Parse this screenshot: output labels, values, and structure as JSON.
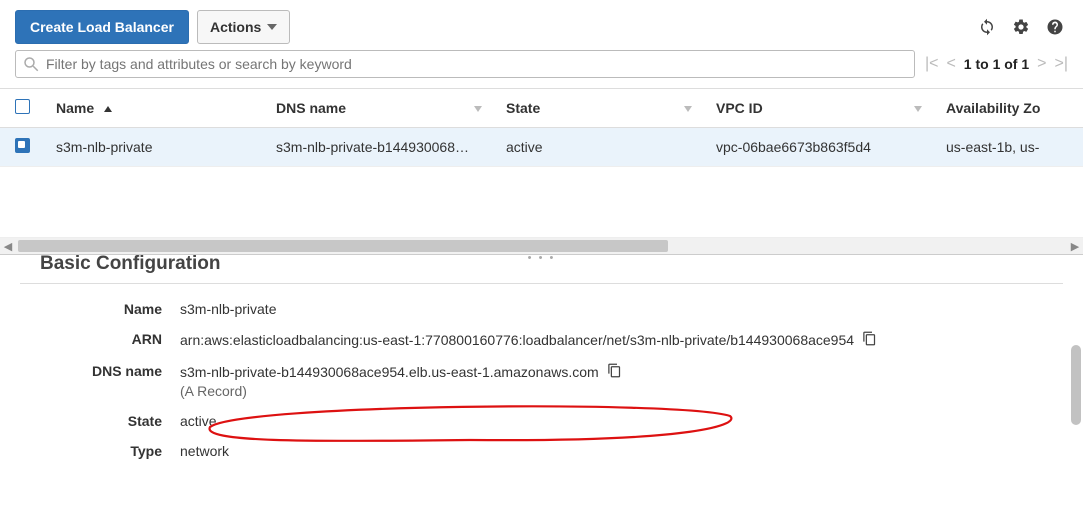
{
  "toolbar": {
    "create_label": "Create Load Balancer",
    "actions_label": "Actions"
  },
  "search": {
    "placeholder": "Filter by tags and attributes or search by keyword"
  },
  "pager": {
    "text": "1 to 1 of 1"
  },
  "columns": {
    "name": "Name",
    "dns": "DNS name",
    "state": "State",
    "vpc": "VPC ID",
    "az": "Availability Zo"
  },
  "rows": [
    {
      "name": "s3m-nlb-private",
      "dns": "s3m-nlb-private-b144930068…",
      "state": "active",
      "vpc": "vpc-06bae6673b863f5d4",
      "az": "us-east-1b, us-"
    }
  ],
  "details": {
    "section_title": "Basic Configuration",
    "name_label": "Name",
    "name_value": "s3m-nlb-private",
    "arn_label": "ARN",
    "arn_value": "arn:aws:elasticloadbalancing:us-east-1:770800160776:loadbalancer/net/s3m-nlb-private/b144930068ace954",
    "dns_label": "DNS name",
    "dns_value": "s3m-nlb-private-b144930068ace954.elb.us-east-1.amazonaws.com",
    "dns_record": "(A Record)",
    "state_label": "State",
    "state_value": "active",
    "type_label": "Type",
    "type_value": "network"
  }
}
